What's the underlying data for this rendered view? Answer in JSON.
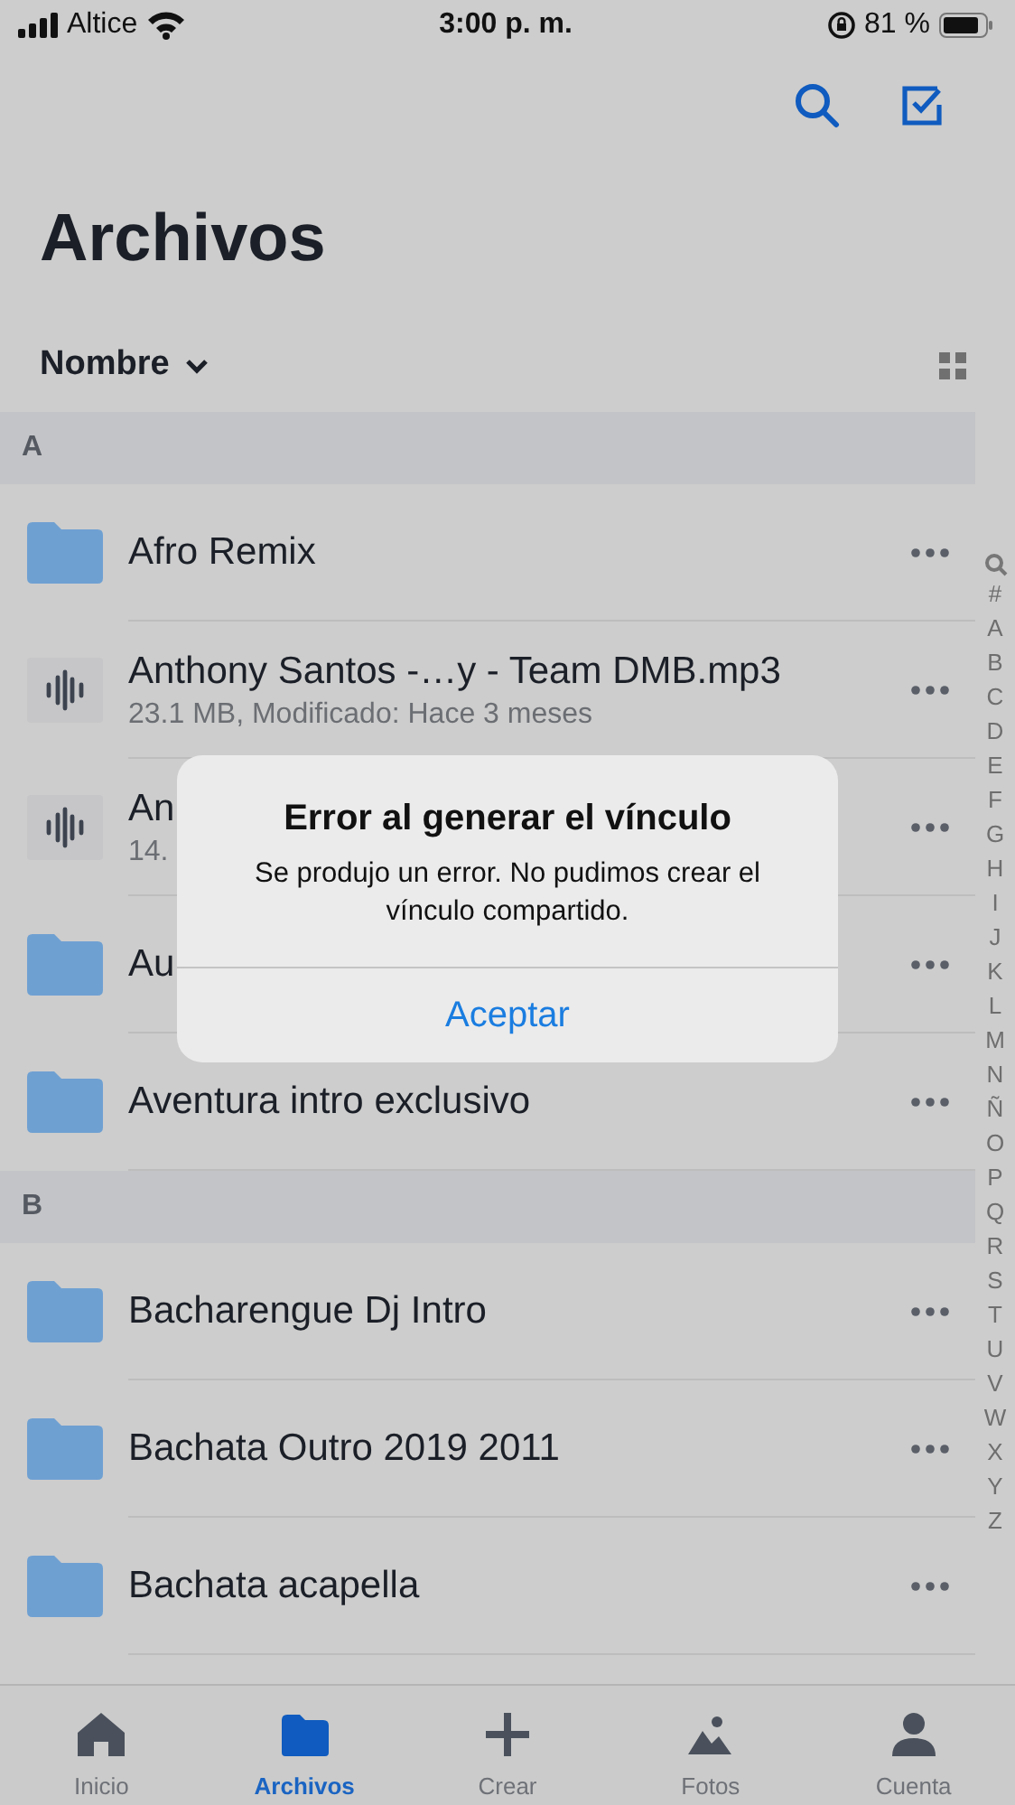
{
  "status_bar": {
    "carrier": "Altice",
    "time": "3:00 p. m.",
    "battery": "81 %"
  },
  "title": "Archivos",
  "sort": {
    "label": "Nombre"
  },
  "sections": [
    {
      "letter": "A",
      "items": [
        {
          "kind": "folder",
          "name": "Afro Remix"
        },
        {
          "kind": "audio",
          "name": "Anthony Santos -…y - Team DMB.mp3",
          "meta": "23.1 MB, Modificado: Hace 3 meses"
        },
        {
          "kind": "audio",
          "name": "An",
          "meta": "14."
        },
        {
          "kind": "folder",
          "name": "Au"
        },
        {
          "kind": "folder",
          "name": "Aventura intro exclusivo"
        }
      ]
    },
    {
      "letter": "B",
      "items": [
        {
          "kind": "folder",
          "name": "Bacharengue Dj Intro"
        },
        {
          "kind": "folder",
          "name": "Bachata  Outro 2019 2011"
        },
        {
          "kind": "folder",
          "name": "Bachata acapella"
        }
      ]
    }
  ],
  "index": [
    "#",
    "A",
    "B",
    "C",
    "D",
    "E",
    "F",
    "G",
    "H",
    "I",
    "J",
    "K",
    "L",
    "M",
    "N",
    "Ñ",
    "O",
    "P",
    "Q",
    "R",
    "S",
    "T",
    "U",
    "V",
    "W",
    "X",
    "Y",
    "Z"
  ],
  "alert": {
    "title": "Error al generar el vínculo",
    "message": "Se produjo un error. No pudimos crear el vínculo compartido.",
    "button": "Aceptar"
  },
  "tabs": [
    {
      "label": "Inicio",
      "selected": false
    },
    {
      "label": "Archivos",
      "selected": true
    },
    {
      "label": "Crear",
      "selected": false
    },
    {
      "label": "Fotos",
      "selected": false
    },
    {
      "label": "Cuenta",
      "selected": false
    }
  ]
}
